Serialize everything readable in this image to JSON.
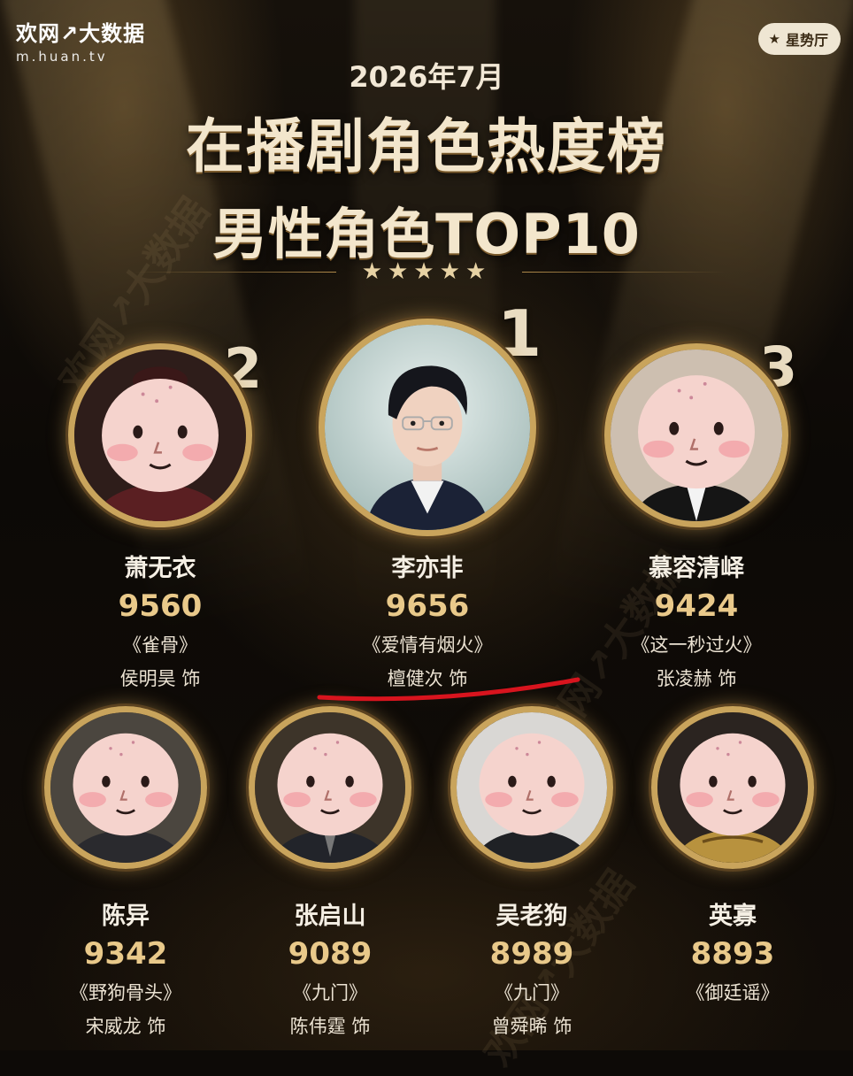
{
  "header": {
    "logo_text": "欢网↗大数据",
    "logo_url": "m.huan.tv",
    "badge_icon": "star-icon",
    "badge_label": "星势厅",
    "date": "2026年7月",
    "title_line1": "在播剧角色热度榜",
    "title_line2": "男性角色TOP10",
    "stars": "★★★★★"
  },
  "ranks": {
    "first": "1",
    "second": "2",
    "third": "3"
  },
  "entries": [
    {
      "name": "李亦非",
      "score": "9656",
      "drama": "《爱情有烟火》",
      "actor": "檀健次 饰"
    },
    {
      "name": "萧无衣",
      "score": "9560",
      "drama": "《雀骨》",
      "actor": "侯明昊 饰"
    },
    {
      "name": "慕容清峄",
      "score": "9424",
      "drama": "《这一秒过火》",
      "actor": "张凌赫 饰"
    },
    {
      "name": "陈异",
      "score": "9342",
      "drama": "《野狗骨头》",
      "actor": "宋威龙 饰"
    },
    {
      "name": "张启山",
      "score": "9089",
      "drama": "《九门》",
      "actor": "陈伟霆 饰"
    },
    {
      "name": "吴老狗",
      "score": "8989",
      "drama": "《九门》",
      "actor": "曾舜晞 饰"
    },
    {
      "name": "英寡",
      "score": "8893",
      "drama": "《御廷谣》",
      "actor": ""
    }
  ],
  "colors": {
    "gold": "#c9a45c",
    "score": "#e9c98a",
    "underline": "#d8141e"
  }
}
